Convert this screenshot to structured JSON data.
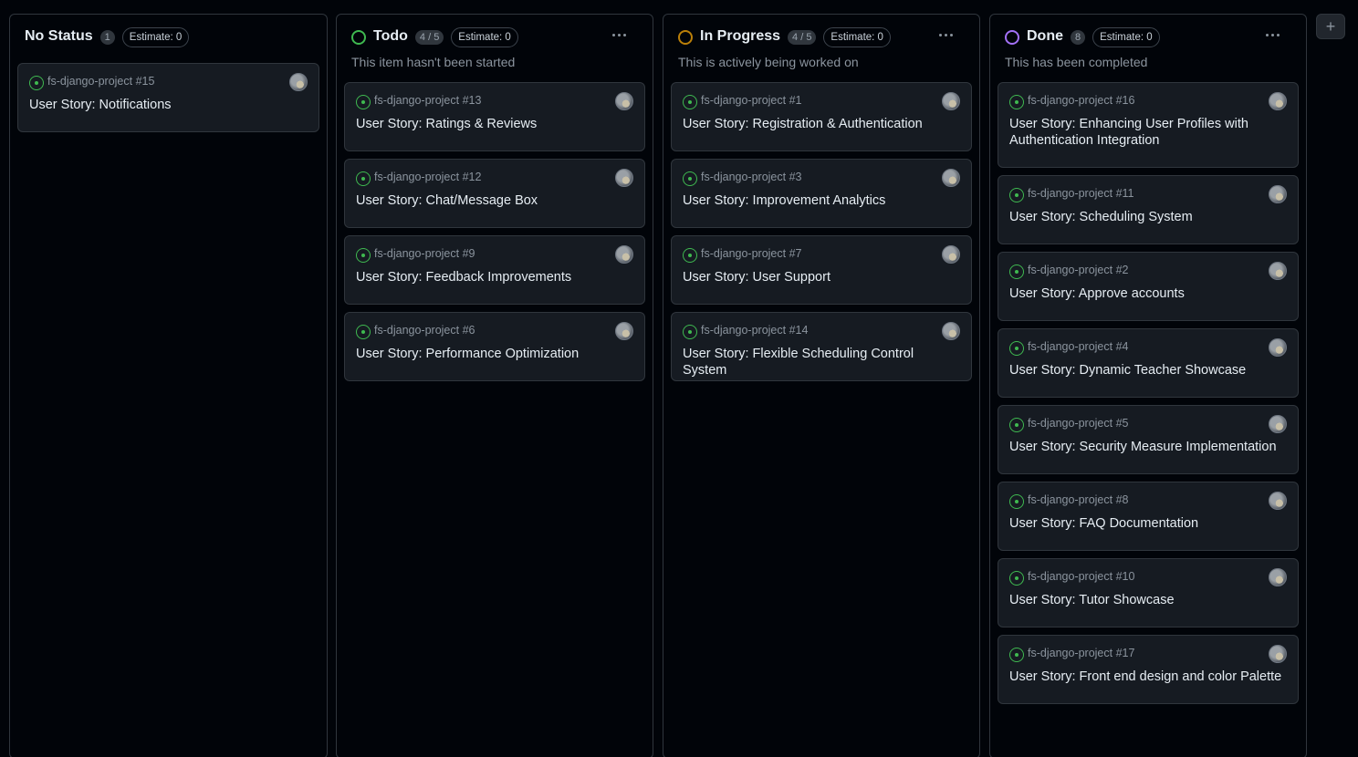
{
  "columns": [
    {
      "title": "No Status",
      "count": "1",
      "estimate": "Estimate: 0",
      "description": "",
      "status_color": "",
      "has_menu": false,
      "cards": [
        {
          "ref": "fs-django-project #15",
          "title": "User Story: Notifications"
        }
      ]
    },
    {
      "title": "Todo",
      "count": "4 / 5",
      "estimate": "Estimate: 0",
      "description": "This item hasn't been started",
      "status_color": "#3fb950",
      "has_menu": true,
      "cards": [
        {
          "ref": "fs-django-project #13",
          "title": "User Story: Ratings & Reviews"
        },
        {
          "ref": "fs-django-project #12",
          "title": "User Story: Chat/Message Box"
        },
        {
          "ref": "fs-django-project #9",
          "title": "User Story: Feedback Improvements"
        },
        {
          "ref": "fs-django-project #6",
          "title": "User Story: Performance Optimization"
        }
      ]
    },
    {
      "title": "In Progress",
      "count": "4 / 5",
      "estimate": "Estimate: 0",
      "description": "This is actively being worked on",
      "status_color": "#bb8009",
      "has_menu": true,
      "cards": [
        {
          "ref": "fs-django-project #1",
          "title": "User Story: Registration & Authentication"
        },
        {
          "ref": "fs-django-project #3",
          "title": "User Story: Improvement Analytics"
        },
        {
          "ref": "fs-django-project #7",
          "title": "User Story: User Support"
        },
        {
          "ref": "fs-django-project #14",
          "title": "User Story: Flexible Scheduling Control System"
        }
      ]
    },
    {
      "title": "Done",
      "count": "8",
      "estimate": "Estimate: 0",
      "description": "This has been completed",
      "status_color": "#a371f7",
      "has_menu": true,
      "cards": [
        {
          "ref": "fs-django-project #16",
          "title": "User Story: Enhancing User Profiles with Authentication Integration"
        },
        {
          "ref": "fs-django-project #11",
          "title": "User Story: Scheduling System"
        },
        {
          "ref": "fs-django-project #2",
          "title": "User Story: Approve accounts"
        },
        {
          "ref": "fs-django-project #4",
          "title": "User Story: Dynamic Teacher Showcase"
        },
        {
          "ref": "fs-django-project #5",
          "title": "User Story: Security Measure Implementation"
        },
        {
          "ref": "fs-django-project #8",
          "title": "User Story: FAQ Documentation"
        },
        {
          "ref": "fs-django-project #10",
          "title": "User Story: Tutor Showcase"
        },
        {
          "ref": "fs-django-project #17",
          "title": "User Story: Front end design and color Palette"
        }
      ]
    }
  ],
  "add_column_label": "+",
  "icons": {
    "issue": "issue-open-icon",
    "status": "status-circle-icon",
    "menu": "ellipsis-icon",
    "avatar": "assignee-avatar"
  },
  "colors": {
    "issue_open": "#3fb950"
  }
}
